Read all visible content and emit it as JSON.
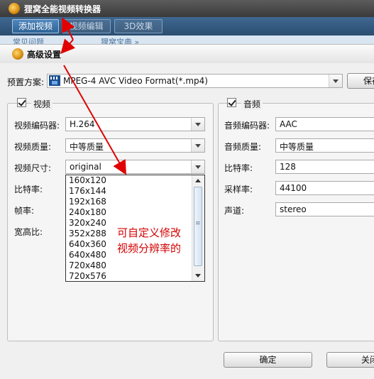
{
  "app": {
    "title": "狸窝全能视频转换器",
    "toolbar": [
      "添加视频",
      "视频编辑",
      "3D效果"
    ],
    "tabs": [
      "常见问题",
      "狸窝宝典 »"
    ]
  },
  "dialog": {
    "title": "高级设置",
    "preset_label": "预置方案:",
    "preset_value": "MPEG-4 AVC Video Format(*.mp4)",
    "save_button": "保存",
    "video": {
      "group_title": "视频",
      "encoder_label": "视频编码器:",
      "encoder_value": "H.264",
      "quality_label": "视频质量:",
      "quality_value": "中等质量",
      "size_label": "视频尺寸:",
      "size_value": "original",
      "bitrate_label": "比特率:",
      "framerate_label": "帧率:",
      "aspect_label": "宽高比:",
      "size_options": [
        "160x120",
        "176x144",
        "192x168",
        "240x180",
        "320x240",
        "352x288",
        "640x360",
        "640x480",
        "720x480",
        "720x576"
      ]
    },
    "audio": {
      "group_title": "音频",
      "encoder_label": "音频编码器:",
      "encoder_value": "AAC",
      "quality_label": "音频质量:",
      "quality_value": "中等质量",
      "bitrate_label": "比特率:",
      "bitrate_value": "128",
      "samplerate_label": "采样率:",
      "samplerate_value": "44100",
      "channel_label": "声道:",
      "channel_value": "stereo"
    },
    "ok_button": "确定",
    "close_button": "关闭"
  },
  "annotation": {
    "line1": "可自定义修改",
    "line2": "视频分辨率的",
    "color": "#d40000"
  }
}
